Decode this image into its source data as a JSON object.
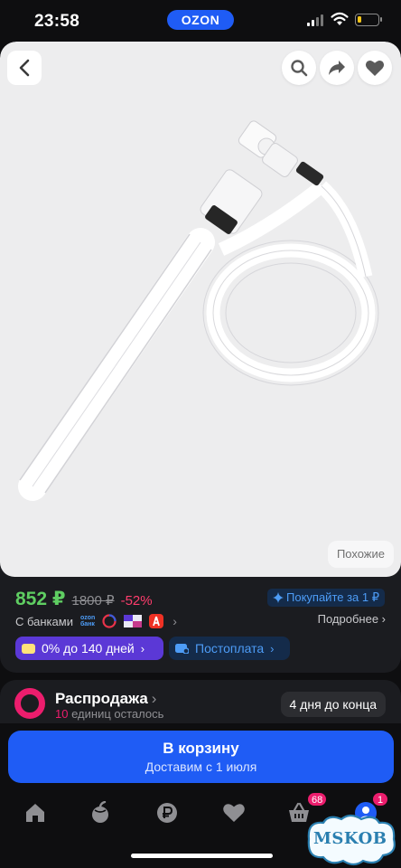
{
  "status_bar": {
    "time": "23:58",
    "app_badge": "OZON",
    "battery_level": 0.2
  },
  "photo": {
    "similar_label": "Похожие"
  },
  "product": {
    "price": "852 ₽",
    "old_price": "1800 ₽",
    "discount": "-52%",
    "buy_for_label": "Покупайте за 1 ₽",
    "banks_label": "С банками",
    "ozon_bank_logo": [
      "ozon",
      "банк"
    ],
    "more_label": "Подробнее",
    "installment_label": "0% до 140 дней",
    "postpay_label": "Постоплата"
  },
  "sale": {
    "title": "Распродажа",
    "units_count": "10",
    "units_text": "единиц осталось",
    "days_left": "4 дня до конца"
  },
  "cart": {
    "button_label": "В корзину",
    "delivery": "Доставим с 1 июля"
  },
  "tabbar": {
    "items": [
      "home-icon",
      "catalog-icon",
      "payments-icon",
      "favorites-icon",
      "cart-icon",
      "profile-icon"
    ],
    "cart_badge": "68",
    "profile_badge": "1"
  },
  "watermark": {
    "text": "MSKOB"
  },
  "colors": {
    "accent_blue": "#1f5cf5",
    "price_green": "#5fce62",
    "discount_pink": "#ff3d6d",
    "sale_magenta": "#ec1d6d",
    "installment_purple": "#5b38d6"
  }
}
